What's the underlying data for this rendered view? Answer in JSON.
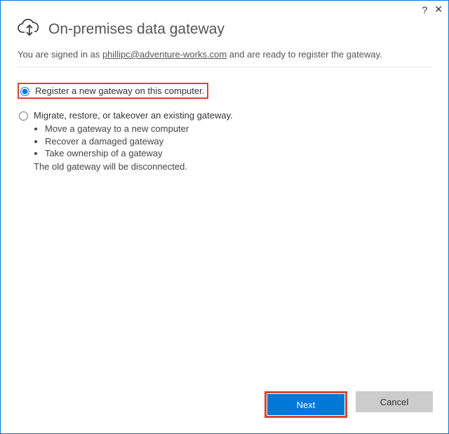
{
  "window": {
    "title": "On-premises data gateway"
  },
  "signed_in_prefix": "You are signed in as ",
  "user_email": "phillipc@adventure-works.com",
  "signed_in_suffix": " and are ready to register the gateway.",
  "option_register": "Register a new gateway on this computer.",
  "option_migrate": "Migrate, restore, or takeover an existing gateway.",
  "bullets": {
    "b1": "Move a gateway to a new computer",
    "b2": "Recover a damaged gateway",
    "b3": "Take ownership of a gateway"
  },
  "note": "The old gateway will be disconnected.",
  "buttons": {
    "next": "Next",
    "cancel": "Cancel"
  },
  "glyphs": {
    "help": "?",
    "close": "✕"
  }
}
